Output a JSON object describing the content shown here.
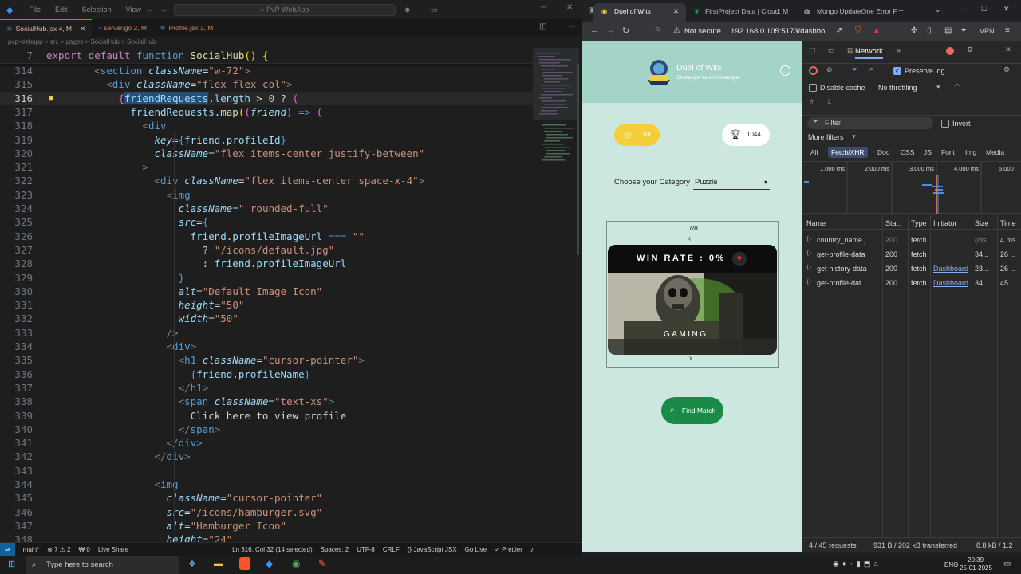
{
  "vscode": {
    "menus": [
      "File",
      "Edit",
      "Selection",
      "View"
    ],
    "search_text": "PvP WebApp",
    "tabs": [
      {
        "label": "SocialHub.jsx 4, M",
        "active": true
      },
      {
        "label": "server.go 2, M",
        "active": false
      },
      {
        "label": "Profile.jsx 3, M",
        "active": false
      }
    ],
    "breadcrumb": "pvp-webapp  >  src  >  pages  >  SocialHub  >  SocialHub",
    "sticky": {
      "ln": "7",
      "text": "export default function SocialHub() {"
    },
    "lines": [
      {
        "ln": "314",
        "text": "        <section className=\"w-72\">"
      },
      {
        "ln": "315",
        "text": "          <div className=\"flex flex-col\">"
      },
      {
        "ln": "316",
        "text": "            {friendRequests.length > 0 ? ("
      },
      {
        "ln": "317",
        "text": "              friendRequests.map((friend) => ("
      },
      {
        "ln": "318",
        "text": "                <div"
      },
      {
        "ln": "319",
        "text": "                  key={friend.profileId}"
      },
      {
        "ln": "320",
        "text": "                  className=\"flex items-center justify-between\""
      },
      {
        "ln": "321",
        "text": "                >"
      },
      {
        "ln": "322",
        "text": "                  <div className=\"flex items-center space-x-4\">"
      },
      {
        "ln": "323",
        "text": "                    <img"
      },
      {
        "ln": "324",
        "text": "                      className=\" rounded-full\""
      },
      {
        "ln": "325",
        "text": "                      src={"
      },
      {
        "ln": "326",
        "text": "                        friend.profileImageUrl === \"\""
      },
      {
        "ln": "327",
        "text": "                          ? \"/icons/default.jpg\""
      },
      {
        "ln": "328",
        "text": "                          : friend.profileImageUrl"
      },
      {
        "ln": "329",
        "text": "                      }"
      },
      {
        "ln": "330",
        "text": "                      alt=\"Default Image Icon\""
      },
      {
        "ln": "331",
        "text": "                      height=\"50\""
      },
      {
        "ln": "332",
        "text": "                      width=\"50\""
      },
      {
        "ln": "333",
        "text": "                    />"
      },
      {
        "ln": "334",
        "text": "                    <div>"
      },
      {
        "ln": "335",
        "text": "                      <h1 className=\"cursor-pointer\">"
      },
      {
        "ln": "336",
        "text": "                        {friend.profileName}"
      },
      {
        "ln": "337",
        "text": "                      </h1>"
      },
      {
        "ln": "338",
        "text": "                      <span className=\"text-xs\">"
      },
      {
        "ln": "339",
        "text": "                        Click here to view profile"
      },
      {
        "ln": "340",
        "text": "                      </span>"
      },
      {
        "ln": "341",
        "text": "                    </div>"
      },
      {
        "ln": "342",
        "text": "                  </div>"
      },
      {
        "ln": "343",
        "text": ""
      },
      {
        "ln": "344",
        "text": "                  <img"
      },
      {
        "ln": "345",
        "text": "                    className=\"cursor-pointer\""
      },
      {
        "ln": "346",
        "text": "                    src=\"/icons/hamburger.svg\""
      },
      {
        "ln": "347",
        "text": "                    alt=\"Hamburger Icon\""
      },
      {
        "ln": "348",
        "text": "                    height=\"24\""
      }
    ],
    "status": {
      "branch": "main*",
      "problems": "⊗ 7 ⚠ 2",
      "ports": "₩ 0",
      "live_share": "Live Share",
      "cursor": "Ln 316, Col 32 (14 selected)",
      "spaces": "Spaces: 2",
      "encoding": "UTF-8",
      "eol": "CRLF",
      "language": "{} JavaScript JSX",
      "golive": "Go Live",
      "prettier": "✓ Prettier"
    }
  },
  "browser": {
    "tabs": [
      {
        "label": "Duel of Wits",
        "active": true
      },
      {
        "label": "FirstProject Data | Cloud: M",
        "active": false
      },
      {
        "label": "Mongo UpdateOne Error F",
        "active": false
      }
    ],
    "not_secure": "Not secure",
    "url": "192.168.0.105:5173/dashbo...",
    "vpn": "VPN",
    "page": {
      "brand_name": "Duel of Wits",
      "brand_tagline": "Challenge Your Knowledge!",
      "coins": "100",
      "trophies": "1044",
      "category_label": "Choose your Category",
      "category_value": "Puzzle",
      "pager": "7/8",
      "win_rate": "WIN RATE : 0%",
      "card_title": "GAMING",
      "find_match": "Find Match"
    }
  },
  "devtools": {
    "panel": "Network",
    "preserve_log": "Preserve log",
    "disable_cache": "Disable cache",
    "throttling": "No throttling",
    "filter_placeholder": "Filter",
    "invert": "Invert",
    "more_filters": "More filters",
    "filter_chips": [
      "All",
      "Fetch/XHR",
      "Doc",
      "CSS",
      "JS",
      "Font",
      "Img",
      "Media"
    ],
    "active_chip": "Fetch/XHR",
    "timeline_ticks": [
      "1,000 ms",
      "2,000 ms",
      "3,000 ms",
      "4,000 ms",
      "5,000"
    ],
    "columns": [
      "Name",
      "Sta...",
      "Type",
      "Initiator",
      "Size",
      "Time"
    ],
    "requests": [
      {
        "name": "country_name.j...",
        "status": "200",
        "type": "fetch",
        "initiator": "",
        "size": "(dis...",
        "time": "4 ms"
      },
      {
        "name": "get-profile-data",
        "status": "200",
        "type": "fetch",
        "initiator": "",
        "size": "34...",
        "time": "26 ..."
      },
      {
        "name": "get-history-data",
        "status": "200",
        "type": "fetch",
        "initiator": "Dashboard",
        "size": "23...",
        "time": "26 ..."
      },
      {
        "name": "get-profile-dat...",
        "status": "200",
        "type": "fetch",
        "initiator": "Dashboard",
        "size": "34...",
        "time": "45 ..."
      }
    ],
    "summary_requests": "4 / 45 requests",
    "summary_transferred": "931 B / 202 kB transferred",
    "summary_resources": "8.8 kB / 1.2"
  },
  "taskbar": {
    "search_placeholder": "Type here to search",
    "lang": "ENG",
    "time": "20:39",
    "date": "25-01-2025"
  }
}
